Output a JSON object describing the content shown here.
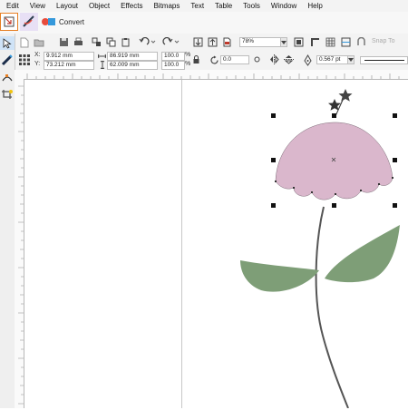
{
  "menu": [
    "Edit",
    "View",
    "Layout",
    "Object",
    "Effects",
    "Bitmaps",
    "Text",
    "Table",
    "Tools",
    "Window",
    "Help"
  ],
  "convert": {
    "label": "Convert"
  },
  "standard": {
    "zoom": "78%",
    "snap_label": "Snap To"
  },
  "property_bar": {
    "x_label": "X:",
    "x_value": "9.912 mm",
    "y_label": "Y:",
    "y_value": "73.212 mm",
    "w_value": "86.919 mm",
    "h_value": "62.009 mm",
    "scale_w": "100.0",
    "scale_h": "100.0",
    "percent": "%",
    "rotation": "0.0",
    "outline_width": "0.567 pt"
  },
  "colors": {
    "petal": "#dab7cc",
    "leaf": "#7e9e77",
    "stem": "#555555",
    "handle": "#111111"
  }
}
